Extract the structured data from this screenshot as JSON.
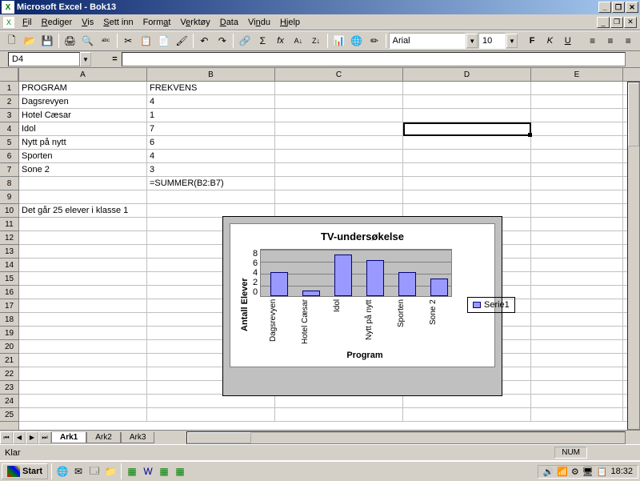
{
  "app": {
    "title": "Microsoft Excel - Bok13"
  },
  "menu": {
    "fil": "Fil",
    "rediger": "Rediger",
    "vis": "Vis",
    "settinn": "Sett inn",
    "format": "Format",
    "verktoy": "Verktøy",
    "data": "Data",
    "vindu": "Vindu",
    "hjelp": "Hjelp"
  },
  "toolbar": {
    "font_name": "Arial",
    "font_size": "10"
  },
  "namebox": "D4",
  "formula": "=",
  "columns": [
    "A",
    "B",
    "C",
    "D",
    "E"
  ],
  "cells": {
    "A1": "PROGRAM",
    "B1": "FREKVENS",
    "A2": "Dagsrevyen",
    "B2": "4",
    "A3": "Hotel Cæsar",
    "B3": "1",
    "A4": "Idol",
    "B4": "7",
    "A5": "Nytt på nytt",
    "B5": "6",
    "A6": "Sporten",
    "B6": "4",
    "A7": "Sone 2",
    "B7": "3",
    "B8": "=SUMMER(B2:B7)",
    "A10": "Det går 25 elever i klasse 1"
  },
  "chart_data": {
    "type": "bar",
    "title": "TV-undersøkelse",
    "xlabel": "Program",
    "ylabel": "Antall Elever",
    "ylim": [
      0,
      8
    ],
    "yticks": [
      "8",
      "6",
      "4",
      "2",
      "0"
    ],
    "categories": [
      "Dagsrevyen",
      "Hotel Cæsar",
      "Idol",
      "Nytt på nytt",
      "Sporten",
      "Sone 2"
    ],
    "values": [
      4,
      1,
      7,
      6,
      4,
      3
    ],
    "series_name": "Serie1"
  },
  "tabs": {
    "t1": "Ark1",
    "t2": "Ark2",
    "t3": "Ark3"
  },
  "status": {
    "ready": "Klar",
    "num": "NUM"
  },
  "taskbar": {
    "start": "Start",
    "clock": "18:32"
  }
}
